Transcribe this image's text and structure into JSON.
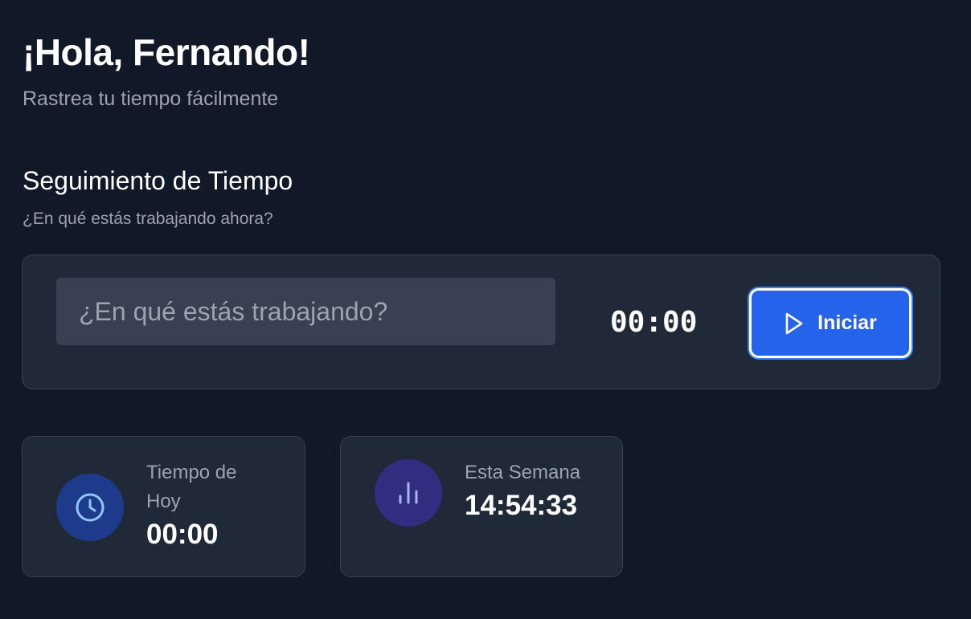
{
  "header": {
    "greeting": "¡Hola, Fernando!",
    "subtitle": "Rastrea tu tiempo fácilmente"
  },
  "tracker": {
    "title": "Seguimiento de Tiempo",
    "prompt": "¿En qué estás trabajando ahora?",
    "input_value": "",
    "input_placeholder": "¿En qué estás trabajando?",
    "timer": "00:00",
    "start_label": "Iniciar",
    "start_icon": "play-icon"
  },
  "stats": {
    "today": {
      "label": "Tiempo de Hoy",
      "value": "00:00",
      "icon": "clock-icon"
    },
    "week": {
      "label": "Esta Semana",
      "value": "14:54:33",
      "icon": "bar-chart-icon"
    }
  },
  "colors": {
    "background": "#111827",
    "card": "#1f2937",
    "accent": "#2563eb",
    "muted_text": "#9ca3af",
    "today_icon_bg": "#1e3a8a",
    "today_icon": "#93c5fd",
    "week_icon_bg": "#312e81",
    "week_icon": "#a5b4fc"
  }
}
